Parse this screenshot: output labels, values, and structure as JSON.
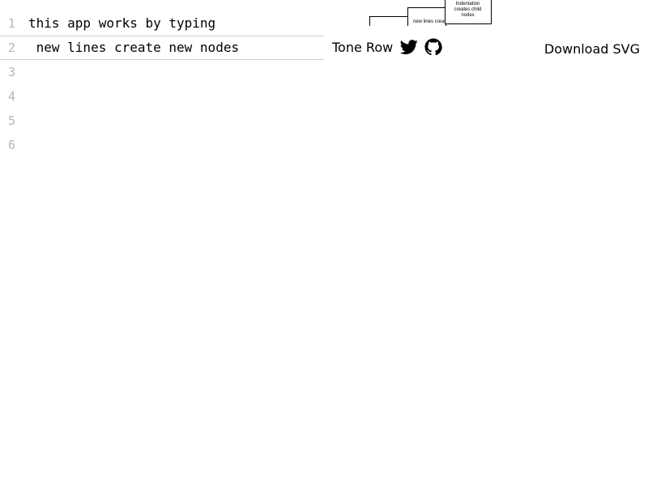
{
  "editor": {
    "lines": [
      {
        "number": "1",
        "text": "this app works by typing"
      },
      {
        "number": "2",
        "text": " new lines create new nodes"
      },
      {
        "number": "3",
        "text": ""
      },
      {
        "number": "4",
        "text": ""
      },
      {
        "number": "5",
        "text": ""
      },
      {
        "number": "6",
        "text": ""
      }
    ]
  },
  "graph_preview": {
    "node_second_label": "new lines creat",
    "node_child_label": [
      "Indentation",
      "creates child",
      "nodes"
    ]
  },
  "toolbar": {
    "brand": "Tone Row",
    "twitter_icon": "twitter-icon",
    "github_icon": "github-icon",
    "download_label": "Download SVG"
  }
}
